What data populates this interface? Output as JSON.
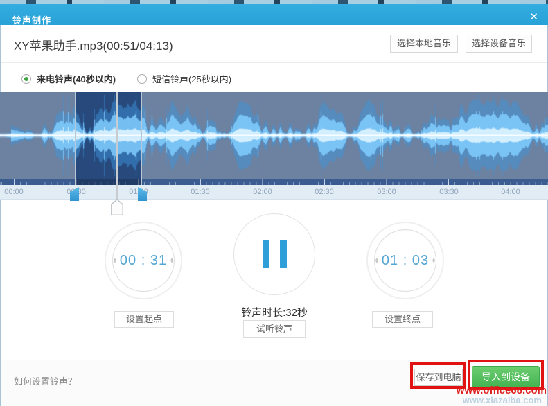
{
  "dialog": {
    "header": {
      "title": "铃声制作",
      "close_icon": "✕"
    },
    "file_row": {
      "filename": "XY苹果助手.mp3(00:51/04:13)",
      "select_local_label": "选择本地音乐",
      "select_device_label": "选择设备音乐"
    },
    "ringtone_type": {
      "call_option": {
        "label": "来电铃声(40秒以内)",
        "selected": true
      },
      "sms_option": {
        "label": "短信铃声(25秒以内)",
        "selected": false
      }
    },
    "timeline": {
      "labels": [
        "00:00",
        "00:30",
        "01:00",
        "01:30",
        "02:00",
        "02:30",
        "03:00",
        "03:30",
        "04:00"
      ],
      "selection_start": "00:31",
      "selection_end": "01:03",
      "playhead_position": "00:51"
    },
    "editor": {
      "start_time_display": "00 : 31",
      "end_time_display": "01 : 03",
      "duration_text": "铃声时长:32秒",
      "set_start_label": "设置起点",
      "preview_label": "试听铃声",
      "set_end_label": "设置终点",
      "playback_state": "paused"
    },
    "footer": {
      "help_link": "如何设置铃声？",
      "save_label": "保存到电脑",
      "import_label": "导入到设备"
    }
  },
  "icons": {
    "spinner_up": "▴",
    "spinner_down": "▾"
  },
  "watermark": {
    "line1": "www.office68.com",
    "line2": "www.xiazaiba.com"
  },
  "colors": {
    "header_blue": "#2ba6dc",
    "accent_blue": "#2e9fd9",
    "time_blue": "#54a6d4",
    "wave_bg": "#6d82a1",
    "selection_navy": "#27497c",
    "green_button": "#52bd5b",
    "annotation_red": "#e01212",
    "watermark_red": "#e02020",
    "radio_green": "#3ba43b"
  }
}
